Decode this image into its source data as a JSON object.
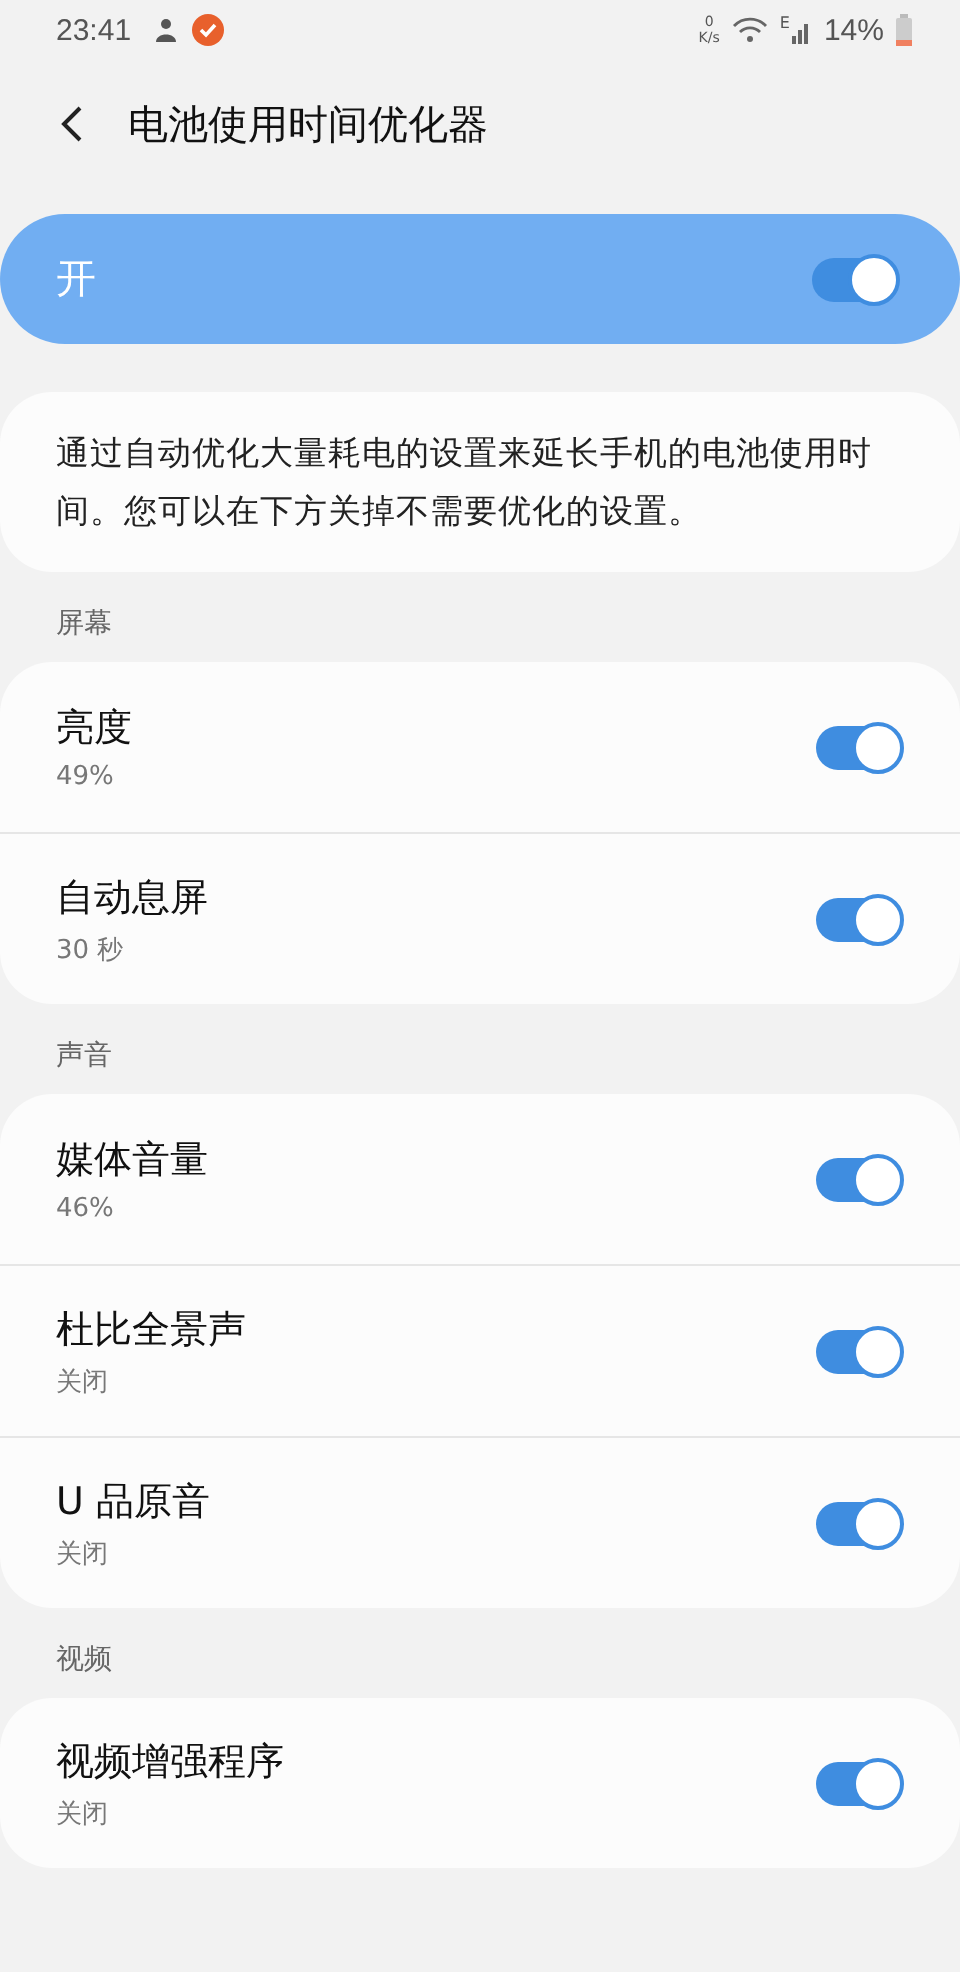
{
  "status_bar": {
    "time": "23:41",
    "net_speed_value": "0",
    "net_speed_unit": "K/s",
    "network_type": "E",
    "battery": "14%"
  },
  "header": {
    "title": "电池使用时间优化器"
  },
  "master": {
    "label": "开",
    "on": true
  },
  "description": "通过自动优化大量耗电的设置来延长手机的电池使用时间。您可以在下方关掉不需要优化的设置。",
  "sections": [
    {
      "title": "屏幕",
      "items": [
        {
          "title": "亮度",
          "subtitle": "49%",
          "on": true
        },
        {
          "title": "自动息屏",
          "subtitle": "30 秒",
          "on": true
        }
      ]
    },
    {
      "title": "声音",
      "items": [
        {
          "title": "媒体音量",
          "subtitle": "46%",
          "on": true
        },
        {
          "title": "杜比全景声",
          "subtitle": "关闭",
          "on": true
        },
        {
          "title": "U 品原音",
          "subtitle": "关闭",
          "on": true
        }
      ]
    },
    {
      "title": "视频",
      "items": [
        {
          "title": "视频增强程序",
          "subtitle": "关闭",
          "on": true
        }
      ]
    }
  ]
}
